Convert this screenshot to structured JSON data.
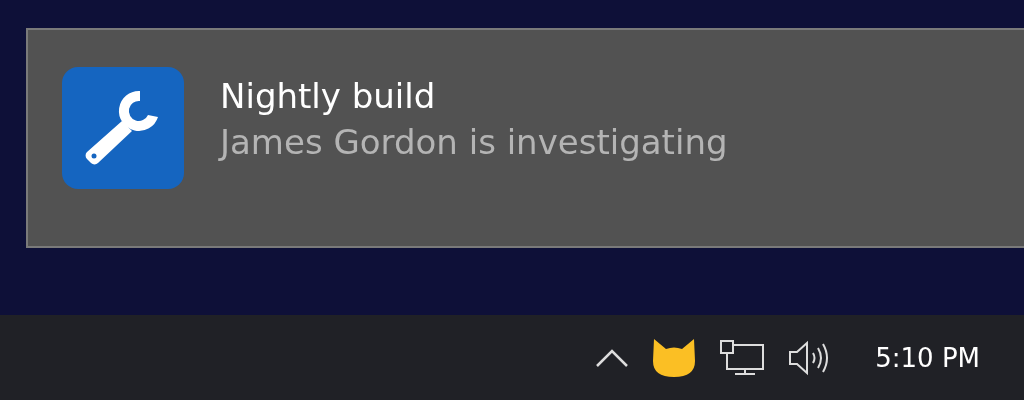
{
  "notification": {
    "title": "Nightly build",
    "message": "James Gordon is investigating"
  },
  "taskbar": {
    "clock": "5:10 PM"
  }
}
